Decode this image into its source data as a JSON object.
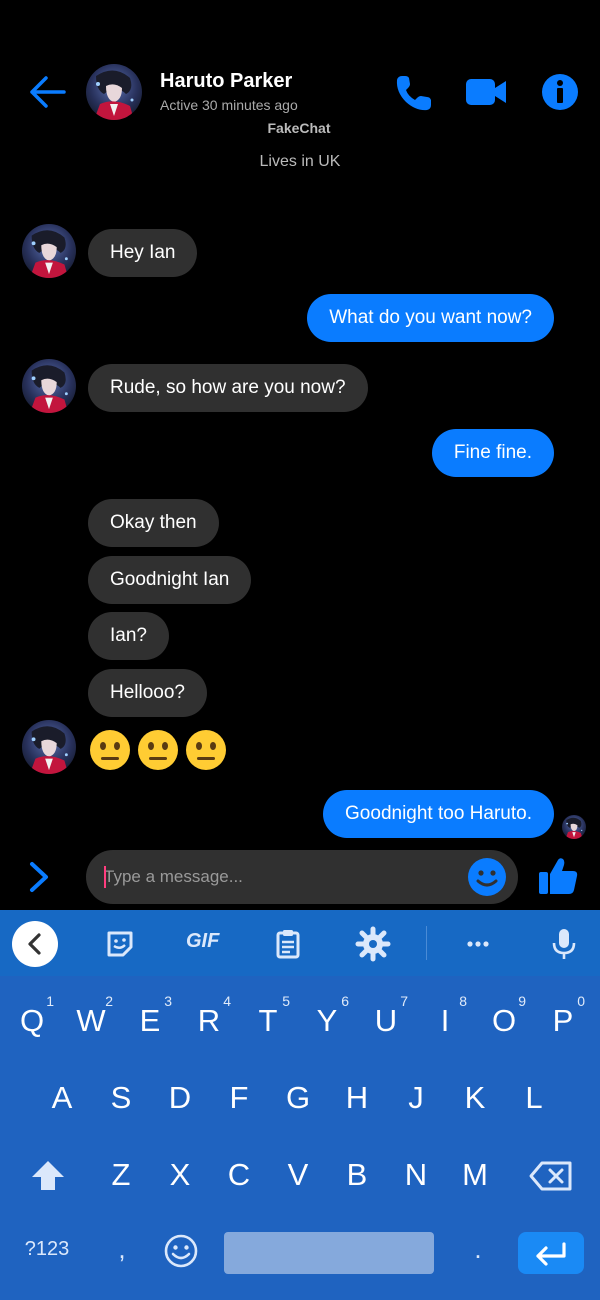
{
  "header": {
    "contact_name": "Haruto Parker",
    "status": "Active 30 minutes ago",
    "app_name": "FakeChat",
    "lives_in": "Lives in UK"
  },
  "colors": {
    "accent": "#0a7cff",
    "incoming_bubble": "#303030",
    "keyboard": "#1f63c0"
  },
  "messages": [
    {
      "from": "them",
      "text": "Hey Ian"
    },
    {
      "from": "me",
      "text": "What do you want now?"
    },
    {
      "from": "them",
      "text": "Rude, so how are you now?"
    },
    {
      "from": "me",
      "text": "Fine fine."
    },
    {
      "from": "them",
      "text": "Okay then"
    },
    {
      "from": "them",
      "text": "Goodnight Ian"
    },
    {
      "from": "them",
      "text": "Ian?"
    },
    {
      "from": "them",
      "text": "Hellooo?"
    },
    {
      "from": "them",
      "text": "😐😐😐"
    },
    {
      "from": "me",
      "text": "Goodnight too Haruto."
    }
  ],
  "composer": {
    "placeholder": "Type a message..."
  },
  "keyboard": {
    "toolbar": {
      "gif_label": "GIF"
    },
    "row1": [
      {
        "key": "Q",
        "hint": "1"
      },
      {
        "key": "W",
        "hint": "2"
      },
      {
        "key": "E",
        "hint": "3"
      },
      {
        "key": "R",
        "hint": "4"
      },
      {
        "key": "T",
        "hint": "5"
      },
      {
        "key": "Y",
        "hint": "6"
      },
      {
        "key": "U",
        "hint": "7"
      },
      {
        "key": "I",
        "hint": "8"
      },
      {
        "key": "O",
        "hint": "9"
      },
      {
        "key": "P",
        "hint": "0"
      }
    ],
    "row2": [
      "A",
      "S",
      "D",
      "F",
      "G",
      "H",
      "J",
      "K",
      "L"
    ],
    "row3": [
      "Z",
      "X",
      "C",
      "V",
      "B",
      "N",
      "M"
    ],
    "bottom": {
      "symbols": "?123",
      "comma": ",",
      "period": "."
    }
  }
}
